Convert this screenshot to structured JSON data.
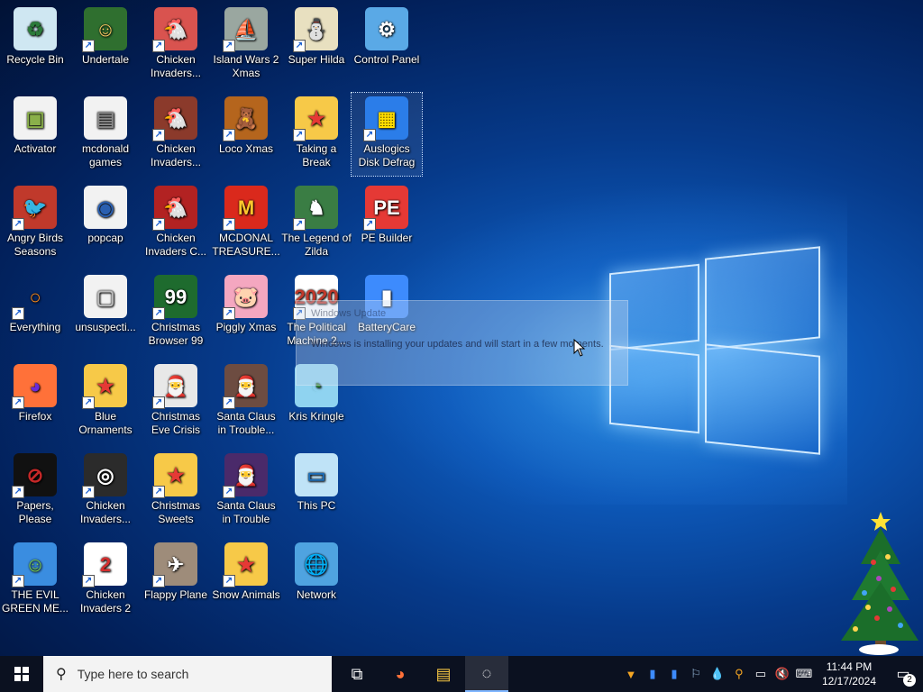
{
  "desktop": {
    "icons": [
      {
        "label": "Recycle Bin",
        "glyph": "♻",
        "bg": "#cfe7f2",
        "fg": "#2c7a3a",
        "shortcut": false
      },
      {
        "label": "Undertale",
        "glyph": "☺",
        "bg": "#2f6f2f",
        "fg": "#ffcc66",
        "shortcut": true
      },
      {
        "label": "Chicken Invaders...",
        "glyph": "🐔",
        "bg": "#d9534f",
        "fg": "#ffffff",
        "shortcut": true
      },
      {
        "label": "Island Wars 2 Xmas",
        "glyph": "⛵",
        "bg": "#9aa7a0",
        "fg": "#ffffff",
        "shortcut": true
      },
      {
        "label": "Super Hilda",
        "glyph": "⛄",
        "bg": "#e8e0c0",
        "fg": "#222222",
        "shortcut": true
      },
      {
        "label": "Control Panel",
        "glyph": "⚙",
        "bg": "#5aa9e6",
        "fg": "#ffffff",
        "shortcut": false
      },
      {
        "label": "Activator",
        "glyph": "▣",
        "bg": "#f2f2f2",
        "fg": "#8ab04a",
        "shortcut": false
      },
      {
        "label": "mcdonald games",
        "glyph": "▤",
        "bg": "#f2f2f2",
        "fg": "#888888",
        "shortcut": false
      },
      {
        "label": "Chicken Invaders...",
        "glyph": "🐔",
        "bg": "#8b3a2b",
        "fg": "#ffd24d",
        "shortcut": true
      },
      {
        "label": "Loco Xmas",
        "glyph": "🧸",
        "bg": "#b5651d",
        "fg": "#ffffff",
        "shortcut": true
      },
      {
        "label": "Taking a Break",
        "glyph": "★",
        "bg": "#f7c948",
        "fg": "#e53935",
        "shortcut": true
      },
      {
        "label": "Auslogics Disk Defrag",
        "glyph": "▦",
        "bg": "#2b7de9",
        "fg": "#ffdd00",
        "shortcut": true
      },
      {
        "label": "Angry Birds Seasons",
        "glyph": "🐦",
        "bg": "#c0392b",
        "fg": "#ffffff",
        "shortcut": true
      },
      {
        "label": "popcap",
        "glyph": "◉",
        "bg": "#f2f2f2",
        "fg": "#2a5fb0",
        "shortcut": false
      },
      {
        "label": "Chicken Invaders C...",
        "glyph": "🐔",
        "bg": "#b22222",
        "fg": "#ffffff",
        "shortcut": true
      },
      {
        "label": "MCDONAL TREASURE...",
        "glyph": "M",
        "bg": "#da291c",
        "fg": "#ffc72c",
        "shortcut": true
      },
      {
        "label": "The Legend of Zilda",
        "glyph": "♞",
        "bg": "#3a7d44",
        "fg": "#ffffff",
        "shortcut": true
      },
      {
        "label": "PE Builder",
        "glyph": "PE",
        "bg": "#e53935",
        "fg": "#ffffff",
        "shortcut": true
      },
      {
        "label": "Everything",
        "glyph": "○",
        "bg": "transparent",
        "fg": "#ff8c1a",
        "shortcut": true
      },
      {
        "label": "unsuspecti...",
        "glyph": "▢",
        "bg": "#f2f2f2",
        "fg": "#bbbbbb",
        "shortcut": false
      },
      {
        "label": "Christmas Browser 99",
        "glyph": "99",
        "bg": "#1e6b2e",
        "fg": "#ffffff",
        "shortcut": true
      },
      {
        "label": "Piggly Xmas",
        "glyph": "🐷",
        "bg": "#f4a7c0",
        "fg": "#ffffff",
        "shortcut": true
      },
      {
        "label": "The Political Machine 2...",
        "glyph": "2020",
        "bg": "#ffffff",
        "fg": "#c0392b",
        "shortcut": true
      },
      {
        "label": "BatteryCare",
        "glyph": "▮",
        "bg": "#3d8bfd",
        "fg": "#ffffff",
        "shortcut": false
      },
      {
        "label": "Firefox",
        "glyph": "◕",
        "bg": "#ff7139",
        "fg": "#6a2bd9",
        "shortcut": true
      },
      {
        "label": "Blue Ornaments",
        "glyph": "★",
        "bg": "#f7c948",
        "fg": "#e53935",
        "shortcut": true
      },
      {
        "label": "Christmas Eve Crisis",
        "glyph": "🎅",
        "bg": "#e8e8e8",
        "fg": "#c62828",
        "shortcut": true
      },
      {
        "label": "Santa Claus in Trouble... A...",
        "glyph": "🎅",
        "bg": "#6d4c41",
        "fg": "#ffffff",
        "shortcut": true
      },
      {
        "label": "Kris Kringle",
        "glyph": "◔",
        "bg": "#8fd3f0",
        "fg": "#2e7d32",
        "shortcut": false
      },
      {
        "label": "Papers, Please",
        "glyph": "⊘",
        "bg": "#111111",
        "fg": "#c62828",
        "shortcut": true
      },
      {
        "label": "Chicken Invaders...",
        "glyph": "◎",
        "bg": "#2b2b2b",
        "fg": "#ffffff",
        "shortcut": true
      },
      {
        "label": "Christmas Sweets",
        "glyph": "★",
        "bg": "#f7c948",
        "fg": "#e53935",
        "shortcut": true
      },
      {
        "label": "Santa Claus in Trouble",
        "glyph": "🎅",
        "bg": "#4a2a6a",
        "fg": "#ffffff",
        "shortcut": true
      },
      {
        "label": "This PC",
        "glyph": "▭",
        "bg": "#bfe3f7",
        "fg": "#1e6fb8",
        "shortcut": false
      },
      {
        "label": "THE EVIL GREEN ME...",
        "glyph": "☺",
        "bg": "#3a8de0",
        "fg": "#7cd04a",
        "shortcut": true
      },
      {
        "label": "Chicken Invaders 2",
        "glyph": "2",
        "bg": "#ffffff",
        "fg": "#d32f2f",
        "shortcut": true
      },
      {
        "label": "Flappy Plane",
        "glyph": "✈",
        "bg": "#9e8c7a",
        "fg": "#ffffff",
        "shortcut": true
      },
      {
        "label": "Snow Animals",
        "glyph": "★",
        "bg": "#f7c948",
        "fg": "#e53935",
        "shortcut": true
      },
      {
        "label": "Network",
        "glyph": "🌐",
        "bg": "#4fa3e0",
        "fg": "#ffffff",
        "shortcut": false
      }
    ],
    "update_notice": {
      "title": "Windows Update",
      "message": "Windows is installing your updates and will start in a few moments."
    }
  },
  "taskbar": {
    "search_placeholder": "Type here to search",
    "pinned": [
      {
        "name": "task-view",
        "glyph": "⧉"
      },
      {
        "name": "firefox",
        "glyph": "◕"
      },
      {
        "name": "file-explorer",
        "glyph": "▤"
      },
      {
        "name": "app-running",
        "glyph": "◌"
      }
    ],
    "tray_icons": [
      "▼",
      "▮",
      "▮",
      "⚐",
      "💧",
      "⚲",
      "▭",
      "🔇",
      "⌨"
    ],
    "time": "11:44 PM",
    "date": "12/17/2024",
    "notification_count": "2"
  },
  "colors": {
    "taskbar_bg": "#0b1120",
    "desktop_accent": "#0d58b8"
  }
}
